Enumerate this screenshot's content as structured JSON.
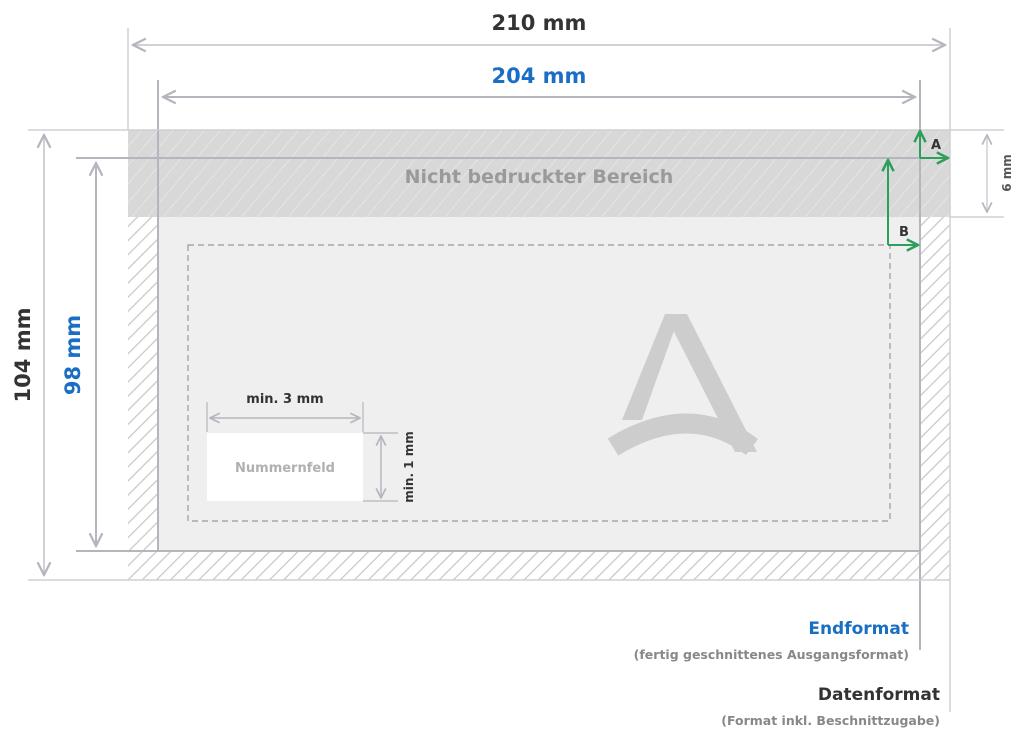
{
  "dimensions": {
    "data_width": "210 mm",
    "end_width": "204 mm",
    "data_height": "104 mm",
    "end_height": "98 mm",
    "top_strip": "6 mm"
  },
  "zones": {
    "non_printed_label": "Nicht bedruckter Bereich"
  },
  "markers": {
    "a": "A",
    "b": "B"
  },
  "number_field": {
    "label": "Nummernfeld",
    "min_width": "min. 3 mm",
    "min_height": "min. 1 mm"
  },
  "legend": {
    "endformat_title": "Endformat",
    "endformat_desc": "(fertig geschnittenes Ausgangsformat)",
    "datenformat_title": "Datenformat",
    "datenformat_desc": "(Format inkl. Beschnittzugabe)"
  },
  "colors": {
    "blue": "#1a6fc4",
    "dark": "#333333",
    "gray_line": "#b5b5bd",
    "green": "#2e9e5b",
    "hatch_bg": "#dcdcdc",
    "area_bg": "#efefef"
  }
}
